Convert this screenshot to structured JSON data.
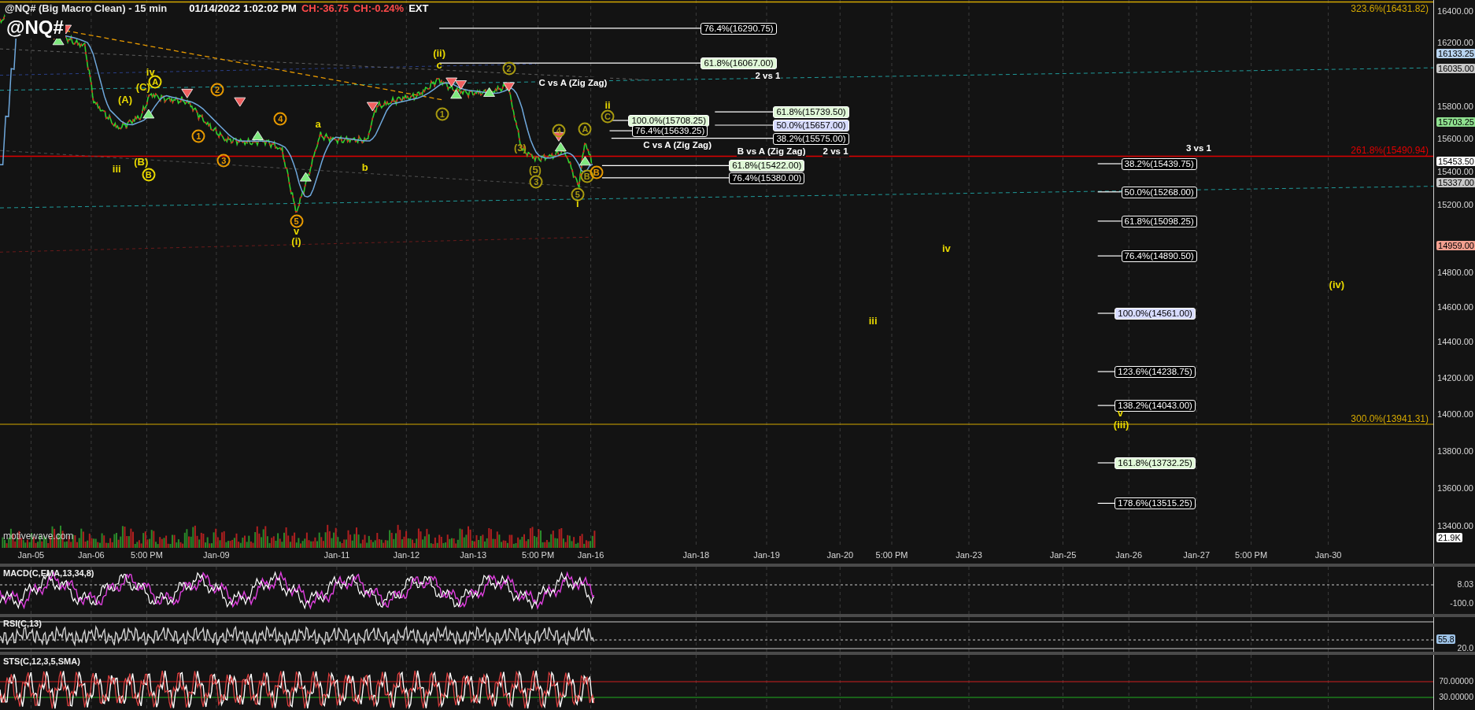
{
  "header": {
    "title": "@NQ# (Big Macro Clean) - 15 min",
    "timestamp": "01/14/2022 1:02:02 PM",
    "change": "CH:-36.75",
    "change_percent": "CH:-0.24%",
    "session": "EXT"
  },
  "symbol": "@NQ#",
  "branding": "motivewave.com",
  "price_axis": {
    "ticks": [
      "16400.00",
      "16200.00",
      "15800.00",
      "15600.00",
      "15400.00",
      "15200.00",
      "14800.00",
      "14600.00",
      "14400.00",
      "14200.00",
      "14000.00",
      "13800.00",
      "13600.00",
      "13400.00"
    ],
    "markers": [
      {
        "text": "16133.25",
        "color": "#b8d4f0"
      },
      {
        "text": "16035.00",
        "color": "#c8c8c8"
      },
      {
        "text": "15703.25",
        "color": "#8fe08f"
      },
      {
        "text": "15453.50",
        "color": "#ffffff"
      },
      {
        "text": "15337.00",
        "color": "#c8c8c8"
      },
      {
        "text": "14959.00",
        "color": "#f4a090"
      },
      {
        "text": "21.9K",
        "color": "#ffffff"
      }
    ]
  },
  "time_axis": {
    "labels": [
      "Jan-05",
      "Jan-06",
      "5:00 PM",
      "Jan-09",
      "Jan-11",
      "Jan-12",
      "Jan-13",
      "5:00 PM",
      "Jan-16",
      "Jan-18",
      "Jan-19",
      "Jan-20",
      "5:00 PM",
      "Jan-23",
      "Jan-25",
      "Jan-26",
      "Jan-27",
      "5:00 PM",
      "Jan-30"
    ]
  },
  "fib_labels": [
    {
      "text": "76.4%(16290.75)",
      "color": "#000000"
    },
    {
      "text": "61.8%(16067.00)",
      "color": "#e0f8d8"
    },
    {
      "text": "100.0%(15708.25)",
      "color": "#e0f8d8"
    },
    {
      "text": "76.4%(15639.25)",
      "color": "#000000"
    },
    {
      "text": "61.8%(15739.50)",
      "color": "#e0f8d8"
    },
    {
      "text": "50.0%(15657.00)",
      "color": "#d8dcff"
    },
    {
      "text": "38.2%(15575.00)",
      "color": "#000000"
    },
    {
      "text": "61.8%(15422.00)",
      "color": "#e0f8d8"
    },
    {
      "text": "76.4%(15380.00)",
      "color": "#000000"
    },
    {
      "text": "38.2%(15439.75)",
      "color": "#000000"
    },
    {
      "text": "50.0%(15268.00)",
      "color": "#000000"
    },
    {
      "text": "61.8%(15098.25)",
      "color": "#000000"
    },
    {
      "text": "76.4%(14890.50)",
      "color": "#000000"
    },
    {
      "text": "100.0%(14561.00)",
      "color": "#d8dcff"
    },
    {
      "text": "123.6%(14238.75)",
      "color": "#000000"
    },
    {
      "text": "138.2%(14043.00)",
      "color": "#000000"
    },
    {
      "text": "161.8%(13732.25)",
      "color": "#e0f8d8"
    },
    {
      "text": "178.6%(13515.25)",
      "color": "#000000"
    }
  ],
  "line_labels": [
    {
      "text": "323.6%(16431.82)",
      "color": "#d4a800"
    },
    {
      "text": "261.8%(15490.94)",
      "color": "#e00000"
    },
    {
      "text": "300.0%(13941.31)",
      "color": "#d4a800"
    }
  ],
  "annotations": [
    "C vs A (Zig Zag)",
    "2 vs 1",
    "C vs A (Zig Zag)",
    "B vs A (Zig Zag)",
    "2 vs 1",
    "3 vs 1"
  ],
  "wave_labels": [
    {
      "text": "(ii)",
      "kind": "plain",
      "color": "#e8d800"
    },
    {
      "text": "c",
      "kind": "plain",
      "color": "#e8d800"
    },
    {
      "text": "5",
      "kind": "circled",
      "color": "#e89a00"
    },
    {
      "text": "v",
      "kind": "plain",
      "color": "#e8d800"
    },
    {
      "text": "(i)",
      "kind": "plain",
      "color": "#e8d800"
    },
    {
      "text": "iv",
      "kind": "plain",
      "color": "#e8d800"
    },
    {
      "text": "A",
      "kind": "circled",
      "color": "#e8d800"
    },
    {
      "text": "(C)",
      "kind": "plain",
      "color": "#e8d800"
    },
    {
      "text": "(A)",
      "kind": "plain",
      "color": "#e8d800"
    },
    {
      "text": "(B)",
      "kind": "plain",
      "color": "#e8d800"
    },
    {
      "text": "iii",
      "kind": "plain",
      "color": "#e8d800"
    },
    {
      "text": "B",
      "kind": "circled",
      "color": "#e8d800"
    },
    {
      "text": "2",
      "kind": "circled",
      "color": "#e89a00"
    },
    {
      "text": "1",
      "kind": "circled",
      "color": "#e89a00"
    },
    {
      "text": "3",
      "kind": "circled",
      "color": "#e89a00"
    },
    {
      "text": "4",
      "kind": "circled",
      "color": "#e89a00"
    },
    {
      "text": "a",
      "kind": "plain",
      "color": "#e8d800"
    },
    {
      "text": "b",
      "kind": "plain",
      "color": "#e8d800"
    },
    {
      "text": "1",
      "kind": "circled",
      "color": "#a89a10"
    },
    {
      "text": "2",
      "kind": "circled",
      "color": "#a89a10"
    },
    {
      "text": "(3)",
      "kind": "plain",
      "color": "#a89a10"
    },
    {
      "text": "(5)",
      "kind": "plain",
      "color": "#a89a10"
    },
    {
      "text": "3",
      "kind": "circled",
      "color": "#a89a10"
    },
    {
      "text": "4",
      "kind": "circled",
      "color": "#a89a10"
    },
    {
      "text": "5",
      "kind": "circled",
      "color": "#a89a10"
    },
    {
      "text": "i",
      "kind": "plain",
      "color": "#e8d800"
    },
    {
      "text": "A",
      "kind": "circled",
      "color": "#a89a10"
    },
    {
      "text": "B",
      "kind": "circled",
      "color": "#a89a10"
    },
    {
      "text": "B",
      "kind": "circled",
      "color": "#e89a00"
    },
    {
      "text": "ii",
      "kind": "plain",
      "color": "#e8d800"
    },
    {
      "text": "C",
      "kind": "circled",
      "color": "#a89a10"
    },
    {
      "text": "iv",
      "kind": "plain",
      "color": "#e8d800"
    },
    {
      "text": "iii",
      "kind": "plain",
      "color": "#e8d800"
    },
    {
      "text": "(iv)",
      "kind": "plain",
      "color": "#e8d800"
    },
    {
      "text": "v",
      "kind": "plain",
      "color": "#e8d800"
    },
    {
      "text": "(iii)",
      "kind": "plain",
      "color": "#e8d800"
    }
  ],
  "indicators": [
    {
      "title": "MACD(C,EMA,13,34,8)",
      "values": [
        {
          "text": "8.03"
        },
        {
          "text": "-100.0"
        }
      ]
    },
    {
      "title": "RSI(C,13)",
      "values": [
        {
          "text": "55.8",
          "color": "#9fc4e8"
        },
        {
          "text": "20.0"
        }
      ]
    },
    {
      "title": "STS(C,12,3,5,SMA)",
      "values": [
        {
          "text": "70.00000"
        },
        {
          "text": "30.00000"
        }
      ]
    }
  ]
}
